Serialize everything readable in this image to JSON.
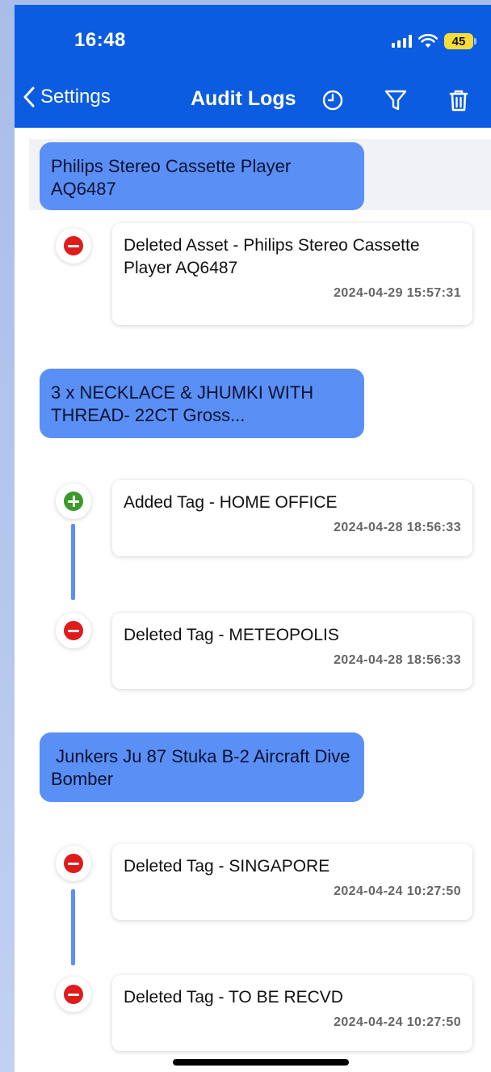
{
  "status_bar": {
    "time": "16:48",
    "battery": "45"
  },
  "nav": {
    "back_label": "Settings",
    "title": "Audit Logs"
  },
  "groups": [
    {
      "title": "Philips Stereo Cassette Player AQ6487",
      "entries": [
        {
          "type": "deleted",
          "text": "Deleted Asset - Philips Stereo Cassette Player AQ6487",
          "timestamp": "2024-04-29 15:57:31"
        }
      ]
    },
    {
      "title": "3 x NECKLACE & JHUMKI WITH THREAD-  22CT Gross...",
      "entries": [
        {
          "type": "added",
          "text": "Added Tag - HOME OFFICE",
          "timestamp": "2024-04-28 18:56:33"
        },
        {
          "type": "deleted",
          "text": "Deleted Tag - METEOPOLIS",
          "timestamp": "2024-04-28 18:56:33"
        }
      ]
    },
    {
      "title": " Junkers Ju 87 Stuka B-2 Aircraft Dive Bomber",
      "entries": [
        {
          "type": "deleted",
          "text": "Deleted Tag - SINGAPORE",
          "timestamp": "2024-04-24 10:27:50"
        },
        {
          "type": "deleted",
          "text": "Deleted Tag - TO BE RECVD",
          "timestamp": "2024-04-24 10:27:50"
        }
      ]
    }
  ],
  "colors": {
    "header": "#0b5ce0",
    "bubble": "#5a8ff5",
    "added": "#3c9a2a",
    "deleted": "#e01b1b"
  }
}
